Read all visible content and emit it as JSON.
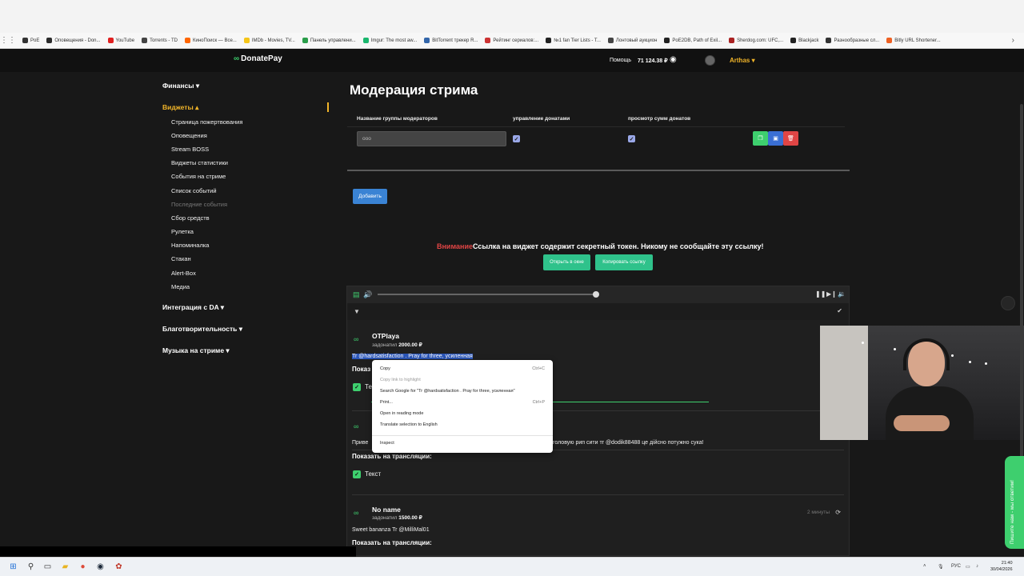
{
  "bookmarks": [
    {
      "label": "PoE",
      "color": "#333333"
    },
    {
      "label": "Оповещения - Don...",
      "color": "#2b2b2b"
    },
    {
      "label": "YouTube",
      "color": "#e02020"
    },
    {
      "label": "Torrents - TD",
      "color": "#444444"
    },
    {
      "label": "КиноПоиск — Все...",
      "color": "#ff6600"
    },
    {
      "label": "IMDb - Movies, TV...",
      "color": "#f5c518"
    },
    {
      "label": "Панель управлени...",
      "color": "#2a9d4a"
    },
    {
      "label": "Imgur: The most aw...",
      "color": "#1bb76e"
    },
    {
      "label": "BitTorrent трекер R...",
      "color": "#3366aa"
    },
    {
      "label": "Рейтинг сериалов:...",
      "color": "#cc3333"
    },
    {
      "label": "№1 fan Tier Lists - T...",
      "color": "#222222"
    },
    {
      "label": "Лонтовый аукцион",
      "color": "#444444"
    },
    {
      "label": "PoE2DB, Path of Exil...",
      "color": "#222222"
    },
    {
      "label": "Sherdog.com: UFC,...",
      "color": "#aa2222"
    },
    {
      "label": "Blackjack",
      "color": "#222222"
    },
    {
      "label": "Разнообразные сл...",
      "color": "#333333"
    },
    {
      "label": "Bitly URL Shortener...",
      "color": "#ee6123"
    }
  ],
  "header": {
    "logo": "DonatePay",
    "help": "Помощь",
    "balance": "71 124.38 ₽",
    "user": "Arthas ▾"
  },
  "sidebar": {
    "finance": "Финансы ▾",
    "widgets": "Виджеты ▴",
    "items": [
      "Страница пожертвования",
      "Оповещения",
      "Stream BOSS",
      "Виджеты статистики",
      "События на стриме",
      "Список событий",
      "Последние события",
      "Сбор средств",
      "Рулетка",
      "Напоминалка",
      "Стакан",
      "Alert-Box",
      "Медиа"
    ],
    "integration": "Интеграция с DA ▾",
    "charity": "Благотворительность ▾",
    "music": "Музыка на стриме ▾"
  },
  "main": {
    "title": "Модерация стрима",
    "col_group": "Название группы модераторов",
    "col_manage": "управление донатами",
    "col_view": "просмотр сумм донатов",
    "group_value": "ооо",
    "add_button": "Добавить",
    "warning_label": "Внимание",
    "warning_text": "Ссылка на виджет содержит секретный токен. Никому не сообщайте эту ссылку!",
    "open_window": "Открыть в окне",
    "copy_link": "Копировать ссылку"
  },
  "donations": [
    {
      "name": "OTPlaya",
      "sum_label": "задонатил",
      "sum": "2000.00 ₽",
      "message": "Tr @hardsatisfaction . Pray for three, усиленная",
      "show_label": "Показ",
      "text_label": "Тек"
    },
    {
      "message_start": "Приве",
      "message_end": "головую рип сити тr @dodik88488 це дійсно потужно сука!",
      "show_label": "Показать на трансляции:",
      "text_label": "Текст"
    },
    {
      "name": "No name",
      "sum_label": "задонатил",
      "sum": "1500.00 ₽",
      "time": "2 минуты",
      "message": "Sweet bananza Tr @MilliMal01",
      "show_label": "Показать на трансляции:"
    }
  ],
  "context_menu": {
    "copy": "Copy",
    "copy_short": "Ctrl+C",
    "copy_link": "Copy link to highlight",
    "search": "Search Google for \"Tr @hardsatisfaction . Pray for three, усиленная\"",
    "print": "Print...",
    "print_short": "Ctrl+P",
    "reading": "Open in reading mode",
    "translate": "Translate selection to English",
    "inspect": "Inspect"
  },
  "chat_tab": "Пишите нам - мы ответим!",
  "taskbar": {
    "lang": "РУС",
    "time": "21:40",
    "date": "30/04/2026"
  }
}
